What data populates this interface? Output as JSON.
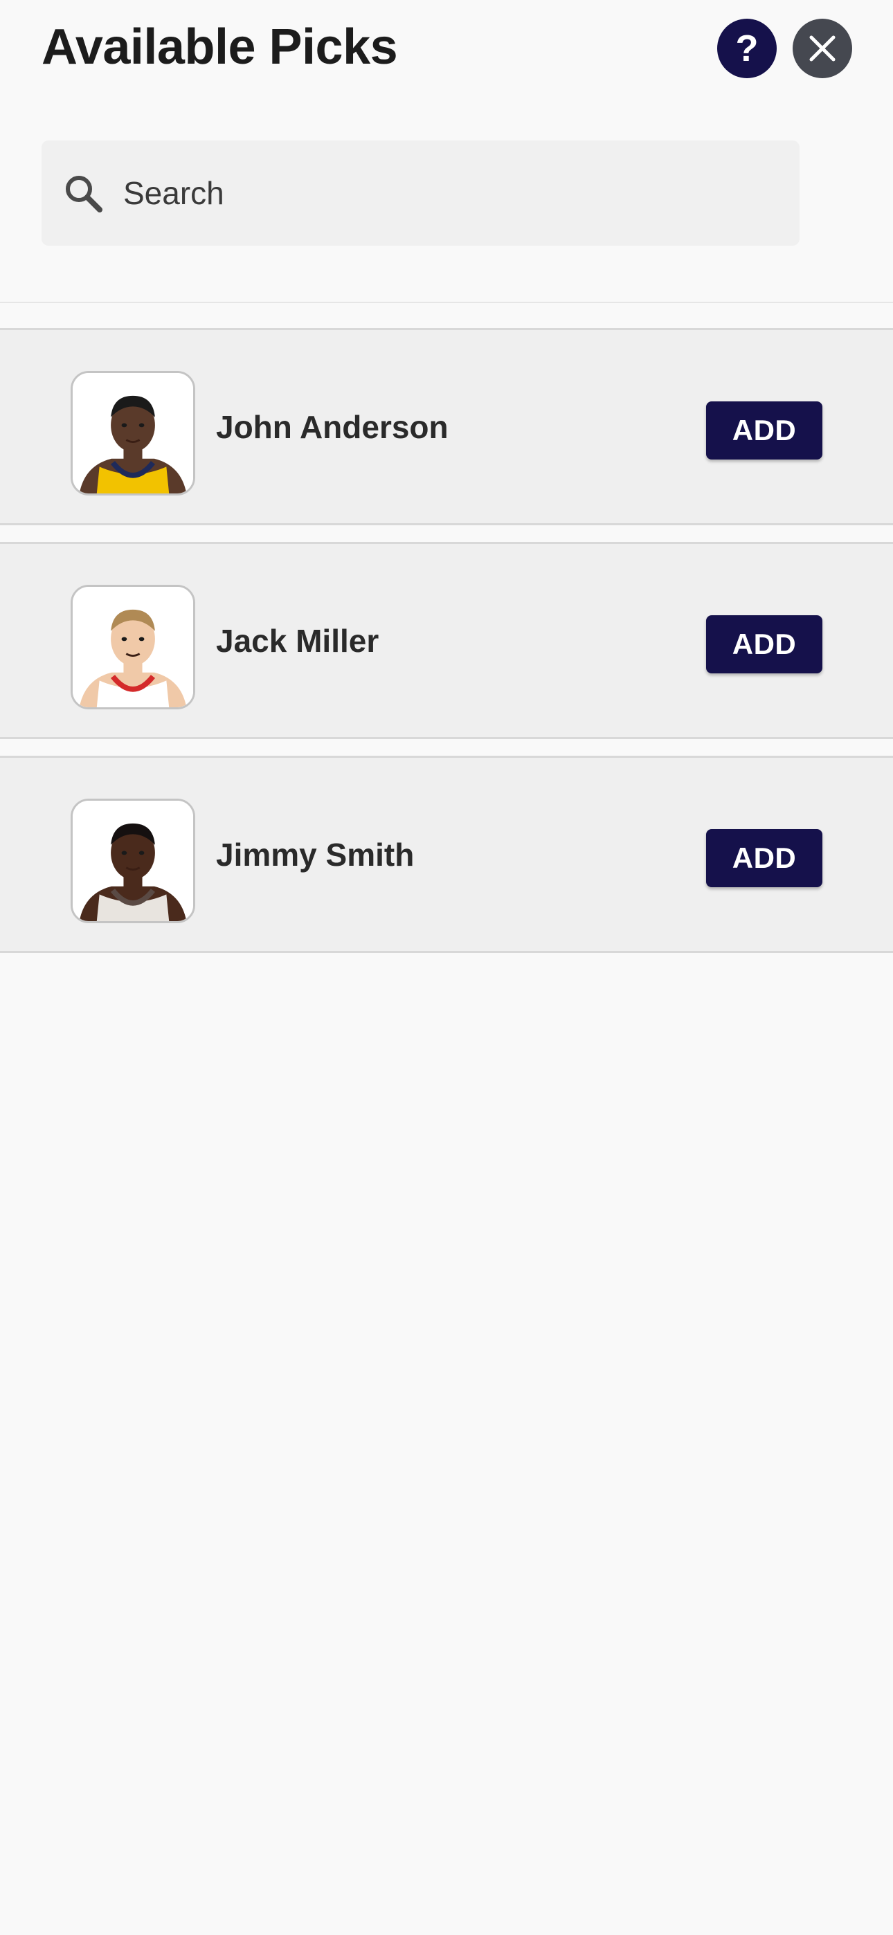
{
  "header": {
    "title": "Available Picks",
    "help_label": "?",
    "help_icon": "question-icon",
    "close_icon": "close-icon"
  },
  "search": {
    "placeholder": "Search",
    "value": "",
    "icon": "search-icon"
  },
  "players": [
    {
      "name": "John Anderson",
      "action_label": "ADD",
      "avatar": {
        "skin": "#5a3a2a",
        "hair": "#1a1a1a",
        "jersey": "#f2c200",
        "trim": "#1e2a5a"
      }
    },
    {
      "name": "Jack Miller",
      "action_label": "ADD",
      "avatar": {
        "skin": "#f0c9a8",
        "hair": "#b08a55",
        "jersey": "#ffffff",
        "trim": "#d42a2a"
      }
    },
    {
      "name": "Jimmy Smith",
      "action_label": "ADD",
      "avatar": {
        "skin": "#4a2a1c",
        "hair": "#151010",
        "jersey": "#e8e4df",
        "trim": "#5a4a44"
      }
    }
  ],
  "colors": {
    "accent": "#15114b",
    "close": "#454850",
    "row_bg": "#efefef",
    "page_bg": "#f9f9f9"
  }
}
